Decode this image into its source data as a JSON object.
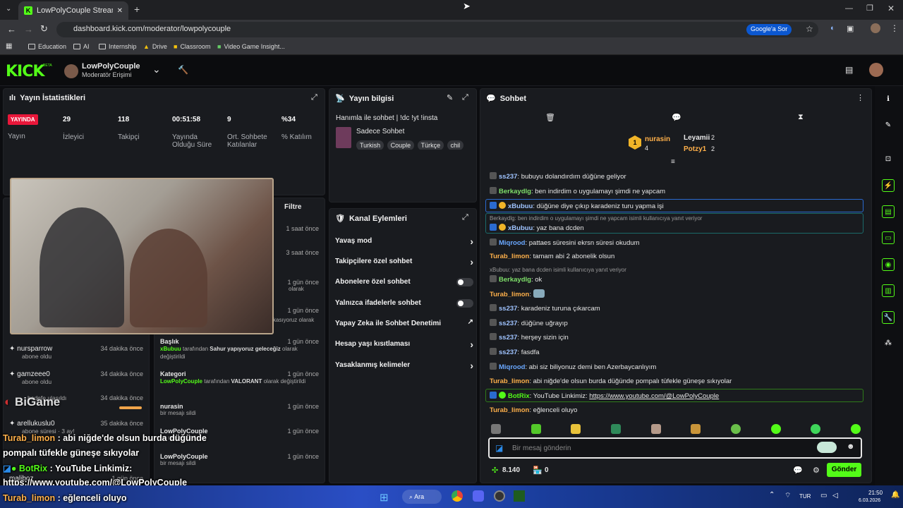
{
  "browser": {
    "tab_title": "LowPolyCouple Stream - Kick D",
    "url": "dashboard.kick.com/moderator/lowpolycouple",
    "google_btn": "Google'a Sor",
    "bookmarks": [
      "Education",
      "AI",
      "Internship",
      "Drive",
      "Classroom",
      "Video Game Insight..."
    ]
  },
  "header": {
    "logo": "KICK",
    "beta": "BETA",
    "channel": "LowPolyCouple",
    "role": "Moderatör Erişimi"
  },
  "stats": {
    "title": "Yayın İstatistikleri",
    "live_badge": "YAYINDA",
    "live_label": "Yayın",
    "items": [
      {
        "value": "29",
        "label": "İzleyici"
      },
      {
        "value": "118",
        "label": "Takipçi"
      },
      {
        "value": "00:51:58",
        "label": "Yayında Olduğu Süre"
      },
      {
        "value": "9",
        "label": "Ort. Sohbete Katılanlar"
      },
      {
        "value": "%34",
        "label": "% Katılım"
      }
    ]
  },
  "info": {
    "title": "Yayın bilgisi",
    "stream_title": "Hanımla ile sohbet | !dc !yt !insta",
    "category": "Sadece Sohbet",
    "tags": [
      "Turkish",
      "Couple",
      "Türkçe",
      "chil"
    ]
  },
  "actions": {
    "title": "Kanal Eylemleri",
    "items": [
      "Yavaş mod",
      "Takipçilere özel sohbet",
      "Abonelere özel sohbet",
      "Yalnızca ifadelerle sohbet",
      "Yapay Zeka ile Sohbet Denetimi",
      "Hesap yaşı kısıtlaması",
      "Yasaklanmış kelimeler"
    ]
  },
  "activity": {
    "filter": "Filtre",
    "left": [
      {
        "name": "nursparrow",
        "sub": "abone oldu",
        "time": "34 dakika önce"
      },
      {
        "name": "gamzeee0",
        "sub": "abone oldu",
        "time": "34 dakika önce"
      },
      {
        "name": "",
        "sub": "hedefe ulaşıldı",
        "time": "34 dakika önce"
      },
      {
        "name": "arellukuslu0",
        "sub": "abone süresi · 3 ay!",
        "time": "35 dakika önce"
      },
      {
        "name": "maliboz",
        "sub": "",
        "time": "1 gün önce"
      }
    ],
    "right_times": [
      "1 saat önce",
      "3 saat önce",
      "1 gün önce",
      "1 gün önce"
    ],
    "right_snips": [
      "olarak",
      "kasıyoruz olarak"
    ],
    "right": [
      {
        "title": "Başlık",
        "user": "xBubuu",
        "mid": "tarafından",
        "val": "Sahur yapıyoruz geleceğiz",
        "end": "olarak değiştirildi",
        "time": "1 gün önce"
      },
      {
        "title": "Kategori",
        "user": "LowPolyCouple",
        "mid": "tarafından",
        "val": "VALORANT",
        "end": "olarak değiştirildi",
        "time": "1 gün önce"
      },
      {
        "title": "nurasin",
        "user": "",
        "mid": "",
        "val": "",
        "end": "bir mesajı sildi",
        "time": "1 gün önce"
      },
      {
        "title": "LowPolyCouple",
        "user": "",
        "mid": "",
        "val": "",
        "end": "bir mesajı sildi",
        "time": "1 gün önce"
      },
      {
        "title": "LowPolyCouple",
        "user": "",
        "mid": "",
        "val": "",
        "end": "bir mesajı sildi",
        "time": "1 gün önce"
      }
    ]
  },
  "chat": {
    "title": "Sohbet",
    "leaders": [
      {
        "name": "nurasin",
        "n": "4"
      },
      {
        "name": "Leyamii",
        "n": "2"
      },
      {
        "name": "Potzy1",
        "n": "2"
      }
    ],
    "messages": [
      {
        "user": "ss237",
        "color": "#9fc3ff",
        "text": "bubuyu dolandırdım düğüne geliyor"
      },
      {
        "user": "Berkaydlg",
        "color": "#7fe06a",
        "text": "ben indirdim o uygulamayı şimdi ne yapcam"
      },
      {
        "user": "xBubuu",
        "color": "#9fc3ff",
        "text": "düğüne diye çıkıp karadeniz turu yapma işi"
      },
      {
        "reply": "Berkaydlg: ben indirdim o uygulamayı şimdi ne yapcam isimli kullanıcıya yanıt veriyor",
        "user": "xBubuu",
        "color": "#9fc3ff",
        "text": "yaz bana dcden"
      },
      {
        "user": "Miqrood",
        "color": "#6aa8ff",
        "text": "pattaes süresini ekrsn süresi okudum"
      },
      {
        "user": "Turab_limon",
        "color": "#ffb04a",
        "text": "tamam abi 2 abonelik olsun"
      },
      {
        "reply": "xBubuu: yaz bana dcden isimli kullanıcıya yanıt veriyor",
        "user": "Berkaydlg",
        "color": "#7fe06a",
        "text": "ok"
      },
      {
        "user": "Turab_limon",
        "color": "#ffb04a",
        "text": ""
      },
      {
        "user": "ss237",
        "color": "#9fc3ff",
        "text": "karadeniz turuna çıkarcam"
      },
      {
        "user": "ss237",
        "color": "#9fc3ff",
        "text": "düğüne uğrayıp"
      },
      {
        "user": "ss237",
        "color": "#9fc3ff",
        "text": "herşey sizin için"
      },
      {
        "user": "ss237",
        "color": "#9fc3ff",
        "text": "fasdfa"
      },
      {
        "user": "Miqrood",
        "color": "#6aa8ff",
        "text": "abi siz biliyonuz demi ben Azerbaycanlıyım"
      },
      {
        "user": "Turab_limon",
        "color": "#ffb04a",
        "text": "abi niğde'de olsun burda düğünde pompalı tüfekle güneşe sıkıyolar"
      },
      {
        "user": "BotRix",
        "color": "#53fc18",
        "text": "YouTube Linkimiz: ",
        "link": "https://www.youtube.com/@LowPolyCouple"
      },
      {
        "user": "Turab_limon",
        "color": "#ffb04a",
        "text": "eğlenceli oluyo"
      }
    ],
    "placeholder": "Bir mesaj gönderin",
    "points": "8.140",
    "points2": "0",
    "send": "Gönder"
  },
  "overlay": {
    "l1_user": "Turab_limon",
    "l1_text": "abi niğde'de olsun burda düğünde",
    "l2": "pompalı tüfekle güneşe sıkıyolar",
    "l3_user": "BotRix",
    "l3_text": "YouTube Linkimiz:",
    "l4": "https://www.youtube.com/@LowPolyCouple",
    "l5_user": "Turab_limon",
    "l5_text": "eğlenceli oluyo",
    "brand": "BiGame"
  },
  "taskbar": {
    "search": "Ara",
    "lang": "TUR",
    "time": "21:50",
    "date": "6.03.2026"
  },
  "colors": {
    "accent": "#53fc18",
    "live": "#e9173a",
    "panel": "#191b1f"
  }
}
